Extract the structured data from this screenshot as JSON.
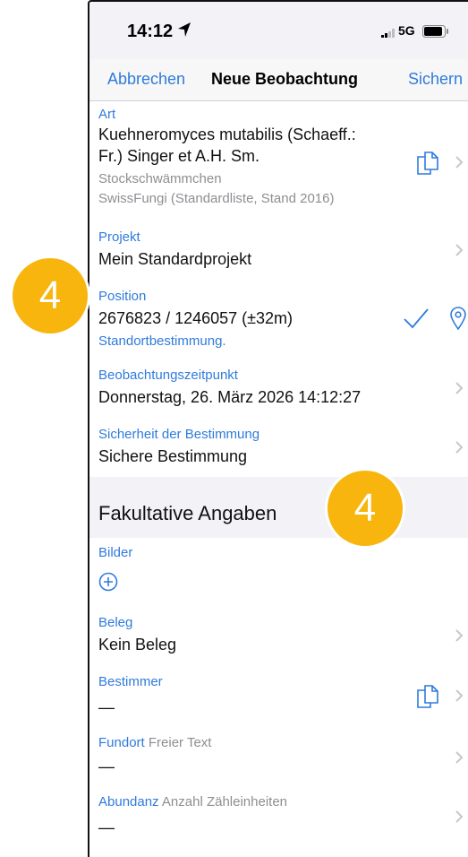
{
  "status_bar": {
    "time": "14:12",
    "network": "5G"
  },
  "navbar": {
    "cancel": "Abbrechen",
    "title": "Neue Beobachtung",
    "save": "Sichern"
  },
  "art": {
    "label": "Art",
    "value_line1": "Kuehneromyces mutabilis (Schaeff.:",
    "value_line2": "Fr.) Singer et A.H. Sm.",
    "common_name": "Stockschwämmchen",
    "list": "SwissFungi (Standardliste, Stand 2016)"
  },
  "projekt": {
    "label": "Projekt",
    "value": "Mein Standardprojekt"
  },
  "position": {
    "label": "Position",
    "value": "2676823 / 1246057 (±32m)",
    "sub": "Standortbestimmung."
  },
  "zeitpunkt": {
    "label": "Beobachtungszeitpunkt",
    "value": "Donnerstag, 26. März 2026 14:12:27"
  },
  "sicherheit": {
    "label": "Sicherheit der Bestimmung",
    "value": "Sichere Bestimmung"
  },
  "section": {
    "title": "Fakultative Angaben"
  },
  "bilder": {
    "label": "Bilder"
  },
  "beleg": {
    "label": "Beleg",
    "value": "Kein Beleg"
  },
  "bestimmer": {
    "label": "Bestimmer",
    "value": "—"
  },
  "fundort": {
    "label": "Fundort",
    "hint": "Freier Text",
    "value": "—"
  },
  "abundanz": {
    "label": "Abundanz",
    "hint": "Anzahl Zähleinheiten",
    "value": "—"
  },
  "badges": {
    "left": "4",
    "right": "4"
  },
  "colors": {
    "accent": "#2f7bdc",
    "badge": "#f7b50e",
    "secondary_text": "#8e8e93"
  }
}
